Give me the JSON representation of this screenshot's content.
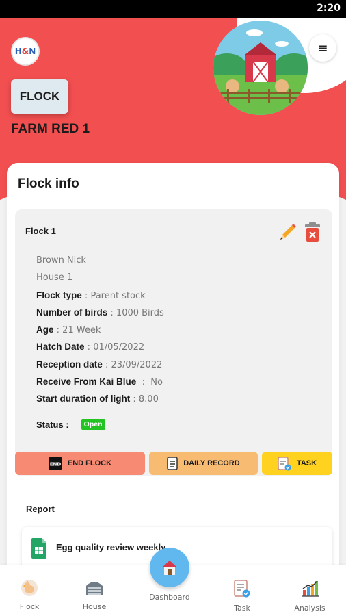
{
  "status_bar": {
    "time": "2:20"
  },
  "header": {
    "logo": {
      "text_primary": "H",
      "text_amp": "&",
      "text_secondary": "N"
    },
    "badge_label": "FLOCK",
    "farm_name": "FARM RED 1",
    "menu_icon": "hamburger-icon",
    "hero_image": "red-barn-illustration"
  },
  "flock_info": {
    "title": "Flock info",
    "flock": {
      "name": "Flock 1",
      "breed": "Brown Nick",
      "house": "House 1",
      "fields": [
        {
          "label": "Flock type",
          "sep": " : ",
          "value": "Parent stock"
        },
        {
          "label": "Number of birds",
          "sep": " : ",
          "value": "1000 Birds"
        },
        {
          "label": "Age",
          "sep": " : ",
          "value": "21 Week"
        },
        {
          "label": "Hatch Date",
          "sep": " : ",
          "value": "01/05/2022"
        },
        {
          "label": "Reception date",
          "sep": " : ",
          "value": "23/09/2022"
        },
        {
          "label": "Receive From Kai Blue",
          "sep": "  :  ",
          "value": "No"
        },
        {
          "label": "Start duration of light",
          "sep": " : ",
          "value": "8.00"
        }
      ],
      "status_label": "Status :",
      "status_value": "Open",
      "status_color": "#22c322"
    },
    "actions": {
      "end_flock": "END FLOCK",
      "daily_record": "DAILY RECORD",
      "task": "TASK"
    }
  },
  "report": {
    "title": "Report",
    "items": [
      {
        "label": "Egg quality review weekly",
        "icon": "google-sheets-icon"
      }
    ]
  },
  "bottom_nav": {
    "items": [
      {
        "label": "Flock",
        "icon": "chicken-icon"
      },
      {
        "label": "House",
        "icon": "house-icon"
      },
      {
        "label": "Dashboard",
        "icon": "dashboard-icon"
      },
      {
        "label": "Task",
        "icon": "task-icon"
      },
      {
        "label": "Analysis",
        "icon": "analysis-icon"
      }
    ]
  },
  "colors": {
    "header_red": "#f24f50",
    "end_flock": "#f68a73",
    "daily_record": "#f8bb72",
    "task": "#ffd21f",
    "dashboard_blue": "#61b8ef"
  }
}
